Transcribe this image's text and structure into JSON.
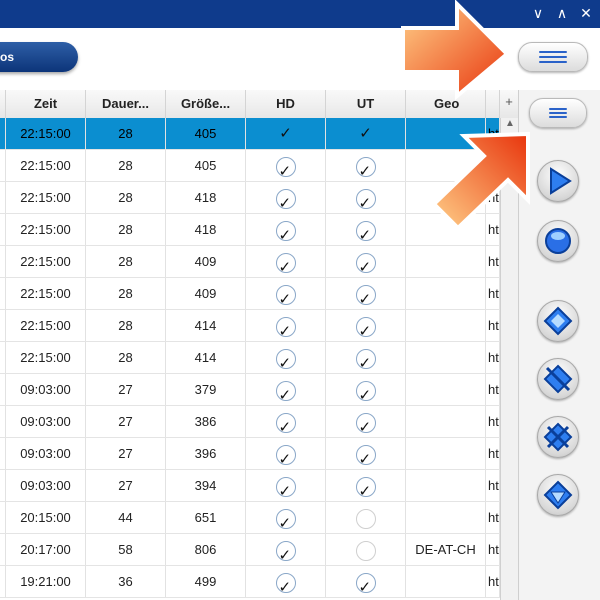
{
  "window": {
    "controls": [
      "∨",
      "∧",
      "✕"
    ]
  },
  "toolbar": {
    "tab_label": "os",
    "menu_icon": "hamburger-icon"
  },
  "table": {
    "columns": [
      "Zeit",
      "Dauer...",
      "Größe...",
      "HD",
      "UT",
      "Geo"
    ],
    "add_column_label": "+",
    "link_fragment": "htt",
    "rows": [
      {
        "zeit": "22:15:00",
        "dauer": "28",
        "groesse": "405",
        "hd": "yes",
        "ut": "yes",
        "geo": "",
        "selected": true
      },
      {
        "zeit": "22:15:00",
        "dauer": "28",
        "groesse": "405",
        "hd": "yes",
        "ut": "yes",
        "geo": "",
        "selected": false
      },
      {
        "zeit": "22:15:00",
        "dauer": "28",
        "groesse": "418",
        "hd": "yes",
        "ut": "yes",
        "geo": "",
        "selected": false
      },
      {
        "zeit": "22:15:00",
        "dauer": "28",
        "groesse": "418",
        "hd": "yes",
        "ut": "yes",
        "geo": "",
        "selected": false
      },
      {
        "zeit": "22:15:00",
        "dauer": "28",
        "groesse": "409",
        "hd": "yes",
        "ut": "yes",
        "geo": "",
        "selected": false
      },
      {
        "zeit": "22:15:00",
        "dauer": "28",
        "groesse": "409",
        "hd": "yes",
        "ut": "yes",
        "geo": "",
        "selected": false
      },
      {
        "zeit": "22:15:00",
        "dauer": "28",
        "groesse": "414",
        "hd": "yes",
        "ut": "yes",
        "geo": "",
        "selected": false
      },
      {
        "zeit": "22:15:00",
        "dauer": "28",
        "groesse": "414",
        "hd": "yes",
        "ut": "yes",
        "geo": "",
        "selected": false
      },
      {
        "zeit": "09:03:00",
        "dauer": "27",
        "groesse": "379",
        "hd": "yes",
        "ut": "yes",
        "geo": "",
        "selected": false
      },
      {
        "zeit": "09:03:00",
        "dauer": "27",
        "groesse": "386",
        "hd": "yes",
        "ut": "yes",
        "geo": "",
        "selected": false
      },
      {
        "zeit": "09:03:00",
        "dauer": "27",
        "groesse": "396",
        "hd": "yes",
        "ut": "yes",
        "geo": "",
        "selected": false
      },
      {
        "zeit": "09:03:00",
        "dauer": "27",
        "groesse": "394",
        "hd": "yes",
        "ut": "yes",
        "geo": "",
        "selected": false
      },
      {
        "zeit": "20:15:00",
        "dauer": "44",
        "groesse": "651",
        "hd": "yes",
        "ut": "no",
        "geo": "",
        "selected": false
      },
      {
        "zeit": "20:17:00",
        "dauer": "58",
        "groesse": "806",
        "hd": "yes",
        "ut": "no",
        "geo": "DE-AT-CH",
        "selected": false
      },
      {
        "zeit": "19:21:00",
        "dauer": "36",
        "groesse": "499",
        "hd": "yes",
        "ut": "yes",
        "geo": "",
        "selected": false
      }
    ]
  },
  "sidebar": {
    "buttons": [
      "menu-icon",
      "play-icon",
      "stop-icon",
      "filter-icon",
      "filter-off-icon",
      "filter-clear-icon",
      "download-icon"
    ]
  },
  "colors": {
    "titlebar": "#0f3b8c",
    "selection": "#0b8ed0",
    "accent": "#2a62c9"
  }
}
